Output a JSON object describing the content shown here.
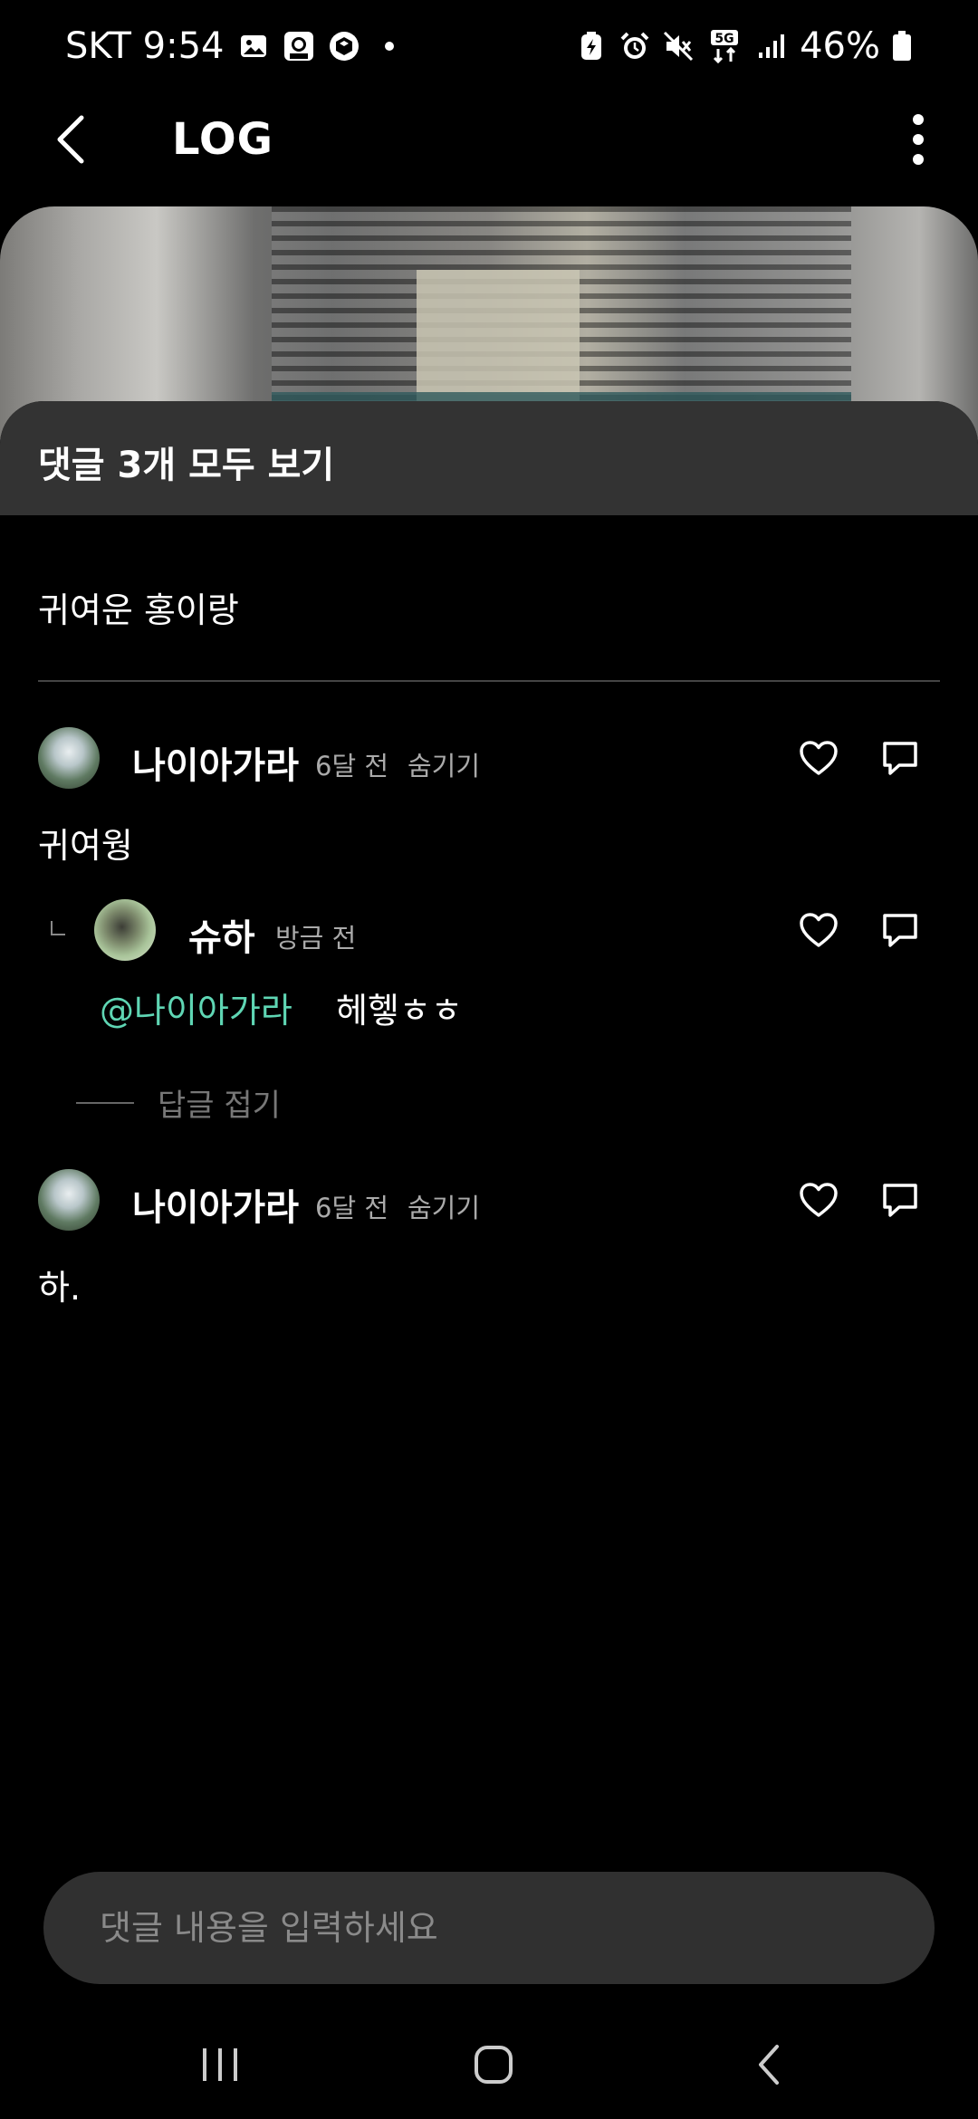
{
  "status_bar": {
    "carrier_time": "SKT 9:54",
    "network": "5G",
    "battery": "46%",
    "icons_left": [
      "gallery-icon",
      "avatar-app-icon",
      "cube-app-icon",
      "dot-icon"
    ],
    "icons_right": [
      "battery-saver-icon",
      "alarm-icon",
      "mute-icon",
      "network-5g-icon",
      "signal-icon",
      "battery-icon"
    ]
  },
  "app_bar": {
    "title": "LOG"
  },
  "sheet": {
    "title": "댓글 3개 모두 보기",
    "caption": "귀여운 홍이랑"
  },
  "comments": [
    {
      "author": "나이아가라",
      "time": "6달 전",
      "hide_label": "숨기기",
      "text": "귀여웡"
    },
    {
      "author": "슈하",
      "time": "방금 전",
      "mention": "@나이아가라",
      "text": "헤헿ㅎㅎ"
    },
    {
      "author": "나이아가라",
      "time": "6달 전",
      "hide_label": "숨기기",
      "text": "하."
    }
  ],
  "collapse_replies_label": "답글 접기",
  "input": {
    "placeholder": "댓글 내용을 입력하세요"
  },
  "colors": {
    "background": "#000000",
    "sheet_header": "#333333",
    "mention": "#5fd6b4",
    "input_bg": "#303030"
  }
}
